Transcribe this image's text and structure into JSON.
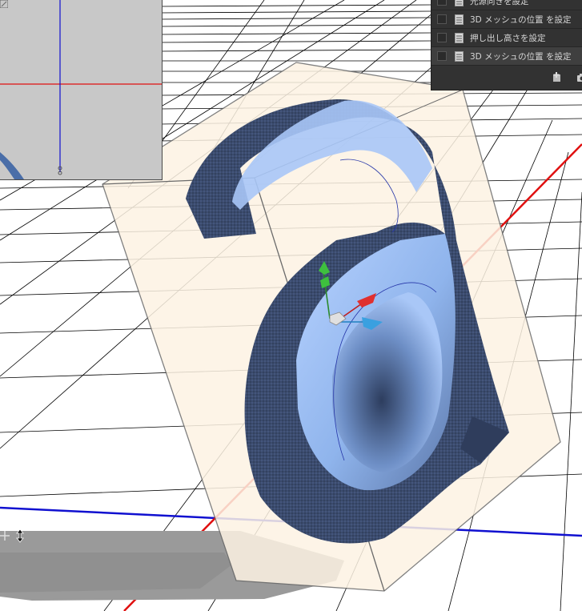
{
  "history_panel": {
    "items": [
      {
        "label": "光源向きを設定",
        "active": false
      },
      {
        "label": "3D メッシュの位置 を設定",
        "active": false
      },
      {
        "label": "押し出し高さを設定",
        "active": false
      },
      {
        "label": "3D メッシュの位置 を設定",
        "active": true
      }
    ],
    "footer_icons": [
      "new-snapshot-icon",
      "camera-icon"
    ]
  },
  "viewport": {
    "object_name": "3D extruded letter mesh",
    "gizmo": {
      "axes": [
        "y-axis-green",
        "x-axis-red",
        "z-axis-blue"
      ]
    },
    "colors": {
      "mesh_face": "#8fb4ec",
      "mesh_side": "#3a4b70",
      "bounding_box_fill": "#fdf3e3",
      "ground_axis_red": "#e01010",
      "ground_axis_blue": "#1010d0",
      "grid": "#000000",
      "secondary_view_bg": "#c8c8c8"
    }
  }
}
